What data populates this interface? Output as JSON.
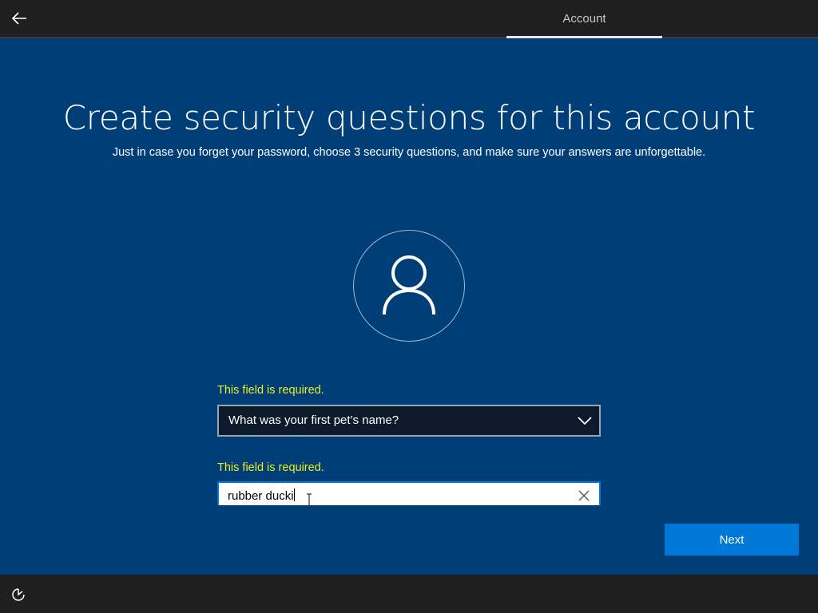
{
  "header": {
    "tab_label": "Account"
  },
  "main": {
    "title": "Create security questions for this account",
    "subtitle": "Just in case you forget your password, choose 3 security questions, and make sure your answers are unforgettable."
  },
  "form": {
    "question_required_message": "This field is required.",
    "question_selected": "What was your first pet’s name?",
    "answer_required_message": "This field is required.",
    "answer_value": "rubber ducki"
  },
  "actions": {
    "next_label": "Next"
  },
  "icons": {
    "back": "back-arrow-icon",
    "avatar": "user-icon",
    "dropdown": "chevron-down-icon",
    "clear": "close-icon",
    "ease_of_access": "ease-of-access-icon"
  },
  "colors": {
    "background": "#003e78",
    "bar": "#1f1f1f",
    "accent": "#0078d7",
    "warning_text": "#e9f022"
  }
}
